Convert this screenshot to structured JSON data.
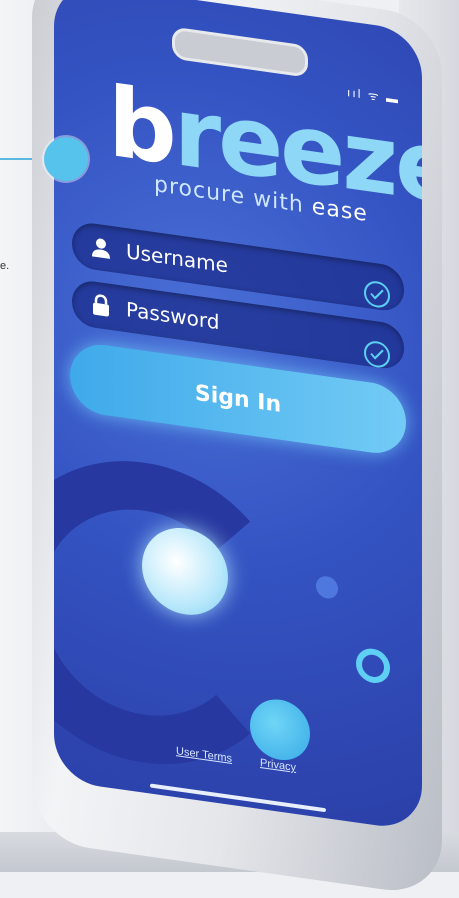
{
  "app": {
    "logo_b": "b",
    "logo_rest": "reeze",
    "tagline_main": "procure with ",
    "tagline_ease": "ease"
  },
  "status_bar": {
    "indicators": "ııl ᯤ ▬"
  },
  "form": {
    "username_label": "Username",
    "password_label": "Password",
    "signin_label": "Sign In"
  },
  "footer": {
    "user_terms": "User Terms",
    "privacy": "Privacy"
  },
  "callout": {
    "snippet": "e."
  },
  "colors": {
    "screen": "#3454c3",
    "accent": "#5cd0f2",
    "button": "#4fb4ee"
  }
}
